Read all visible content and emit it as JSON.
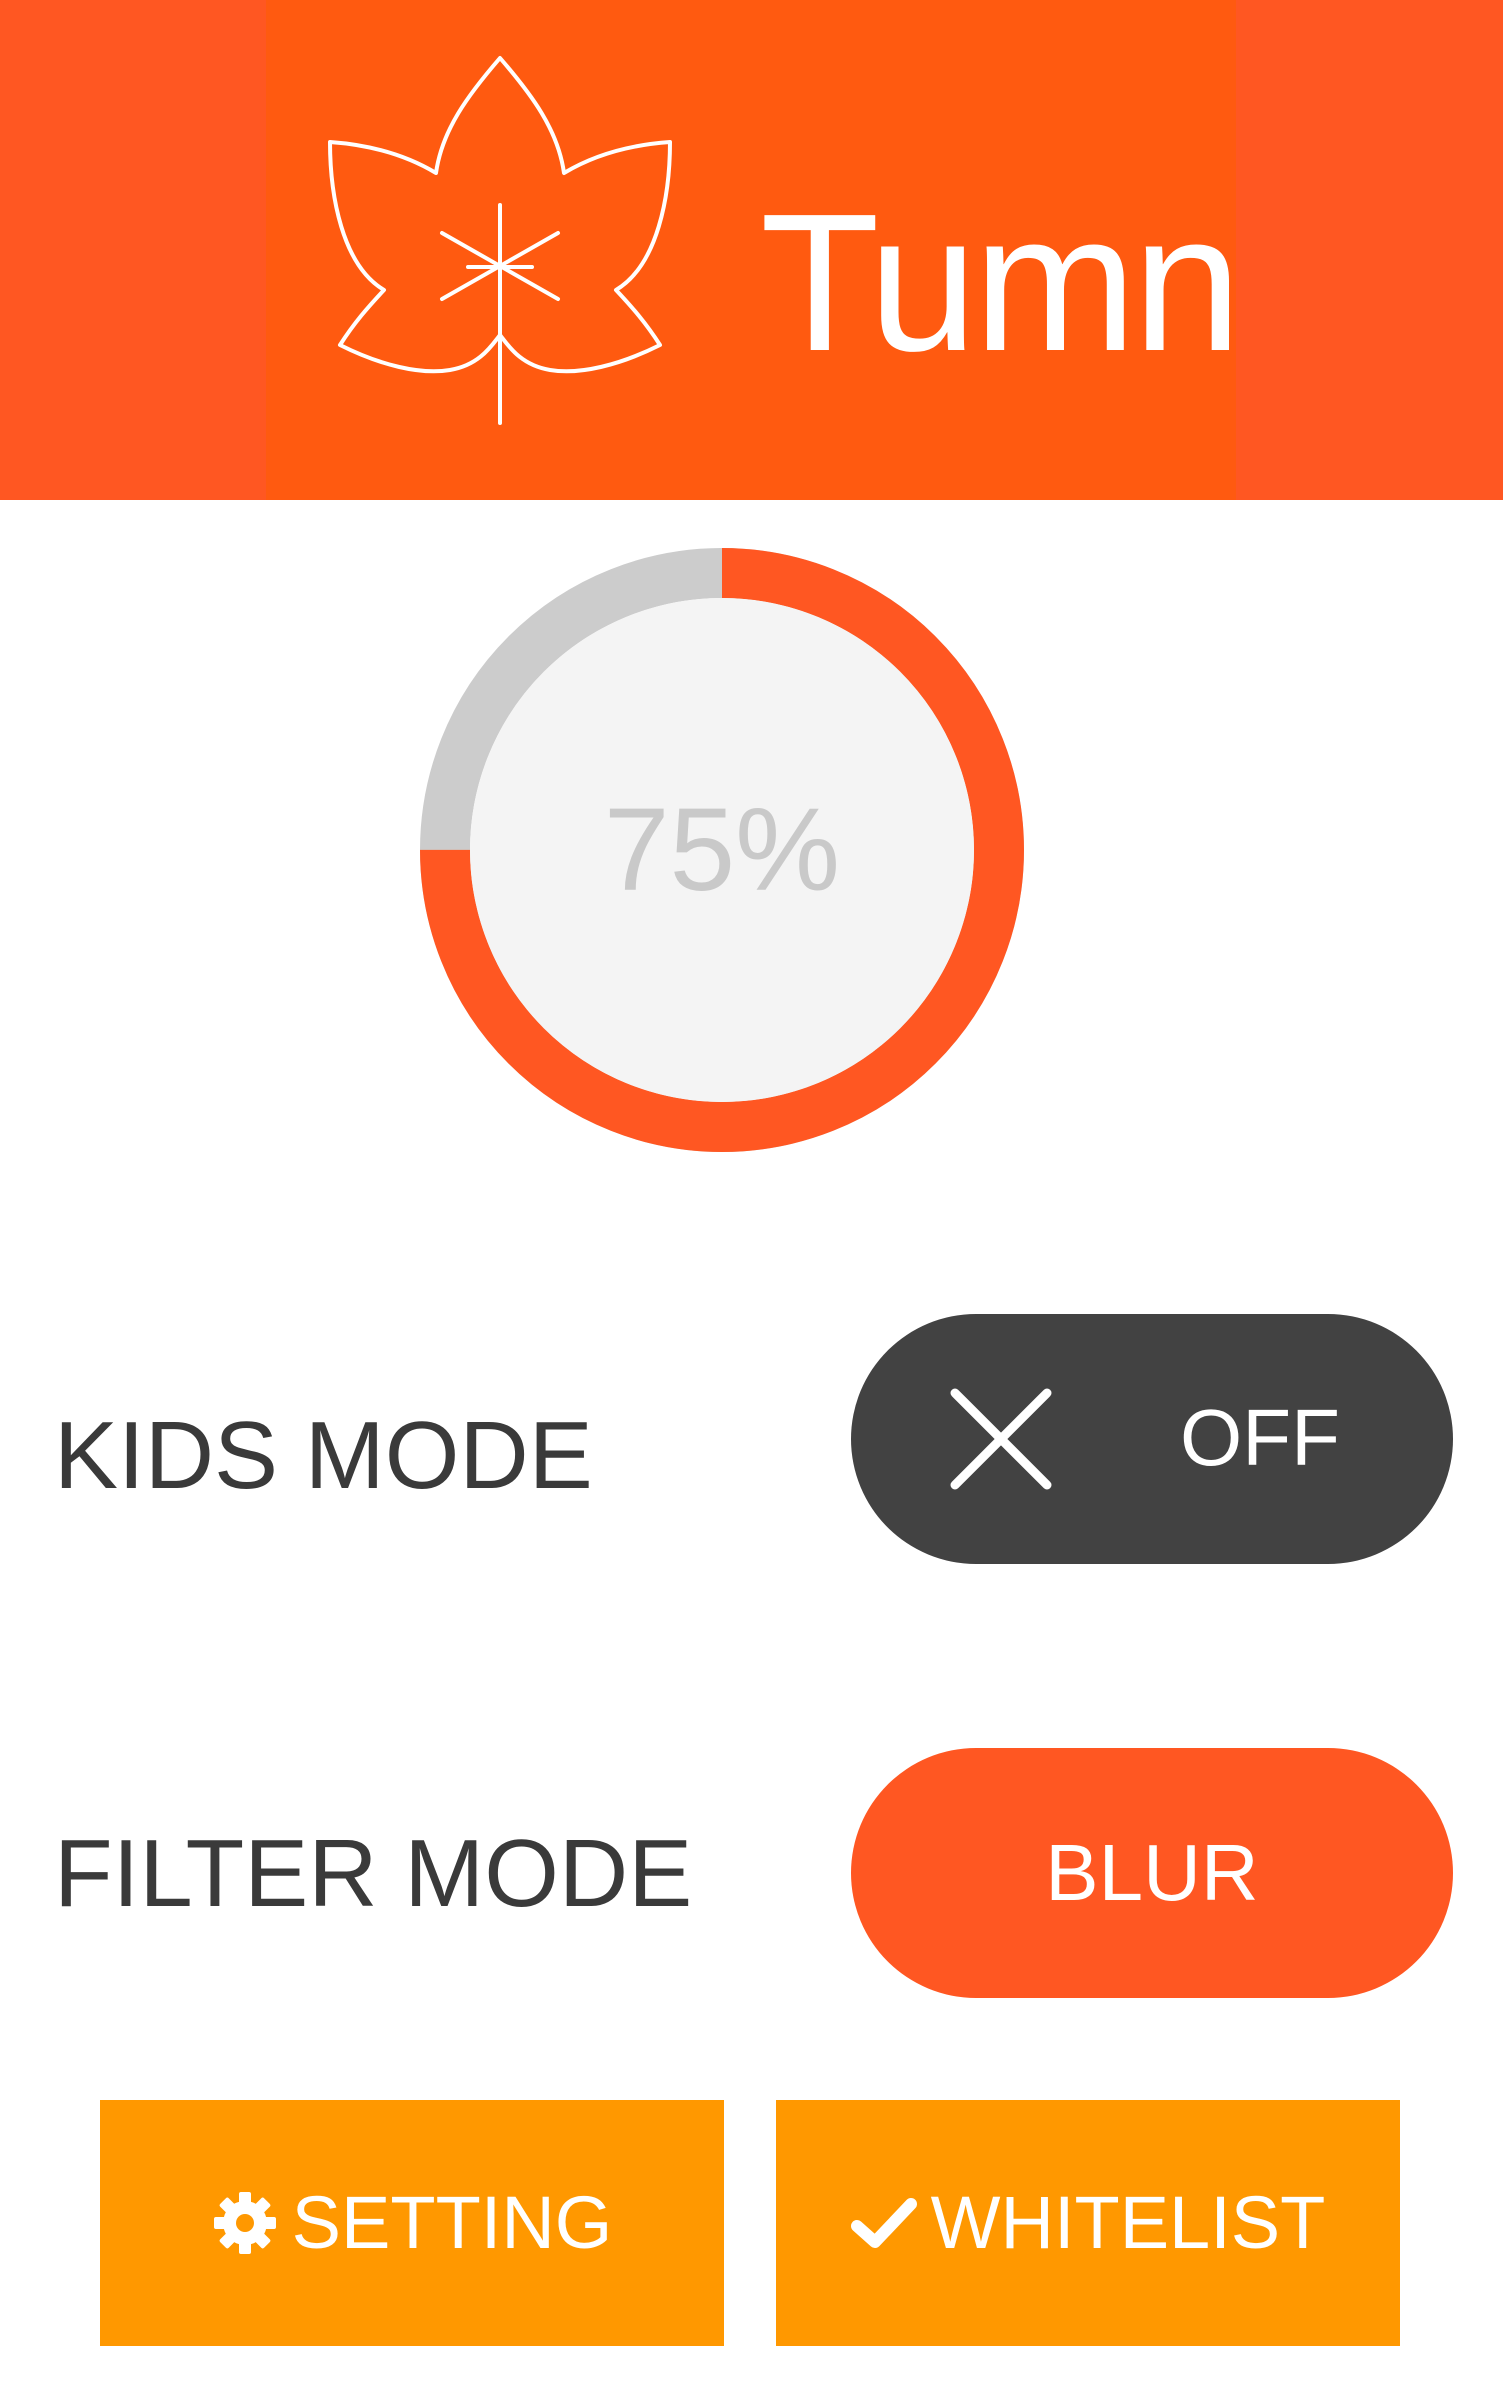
{
  "app": {
    "title": "Tumn",
    "logo_icon": "maple-leaf-icon"
  },
  "colors": {
    "header_bg": "#ff5722",
    "header_inner_bg": "#ff5a10",
    "accent": "#ff5722",
    "toggle_off_bg": "#424242",
    "button_bg": "#ff9800",
    "progress_track": "#cccccc",
    "progress_center": "#f4f4f4"
  },
  "progress": {
    "label": "75%",
    "value": 0.75
  },
  "kids_mode": {
    "label": "KIDS MODE",
    "state_label": "OFF",
    "icon": "close-icon"
  },
  "filter_mode": {
    "label": "FILTER MODE",
    "value_label": "BLUR"
  },
  "buttons": {
    "setting": {
      "label": "SETTING",
      "icon": "gear-icon"
    },
    "whitelist": {
      "label": "WHITELIST",
      "icon": "check-icon"
    }
  }
}
